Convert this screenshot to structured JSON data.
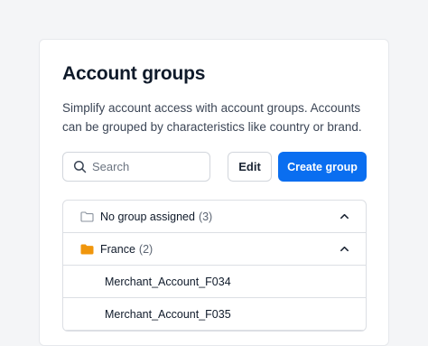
{
  "title": "Account groups",
  "description": "Simplify account access with account groups. Accounts can be grouped by characteristics like country or brand.",
  "search": {
    "placeholder": "Search",
    "icon": "search-icon"
  },
  "buttons": {
    "edit_label": "Edit",
    "create_label": "Create group"
  },
  "groups": [
    {
      "name": "No group assigned",
      "count": "(3)",
      "icon": "folder-outline-icon",
      "expanded": true
    },
    {
      "name": "France",
      "count": "(2)",
      "icon": "folder-filled-icon",
      "expanded": true,
      "accounts": [
        "Merchant_Account_F034",
        "Merchant_Account_F035"
      ]
    }
  ],
  "colors": {
    "accent": "#0a6ef0",
    "folder_filled": "#f0960c",
    "text_primary": "#0f1a2a",
    "border": "#dcdfe4",
    "page_background": "#f4f5f7"
  }
}
